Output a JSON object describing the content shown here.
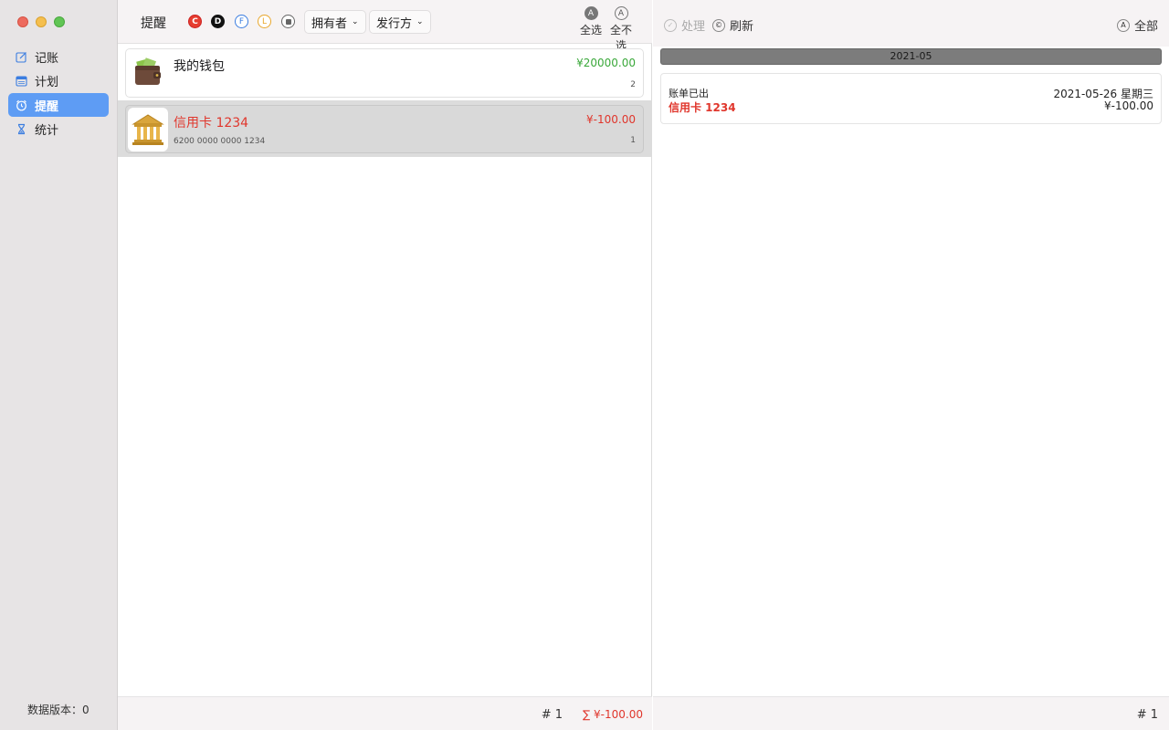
{
  "sidebar": {
    "items": [
      {
        "label": "记账",
        "icon": "edit-icon",
        "active": false
      },
      {
        "label": "计划",
        "icon": "calendar-icon",
        "active": false
      },
      {
        "label": "提醒",
        "icon": "alarm-clock-icon",
        "active": true
      },
      {
        "label": "统计",
        "icon": "hourglass-icon",
        "active": false
      }
    ],
    "footer": "数据版本：0"
  },
  "middle": {
    "title": "提醒",
    "filters": {
      "c": "C",
      "d": "D",
      "f": "F",
      "l": "L"
    },
    "owner_dropdown": "拥有者",
    "issuer_dropdown": "发行方",
    "select_all": {
      "icon": "A",
      "label": "全选"
    },
    "select_none": {
      "icon": "A",
      "label": "全不选"
    },
    "accounts": [
      {
        "name": "我的钱包",
        "amount": "¥20000.00",
        "sub": "",
        "count": "2",
        "icon": "wallet-icon",
        "amount_color": "#3aa83a"
      },
      {
        "name": "信用卡 1234",
        "amount": "¥-100.00",
        "sub": "6200 0000 0000 1234",
        "count": "1",
        "icon": "bank-icon",
        "amount_color": "#e0362c",
        "selected": true
      }
    ],
    "footer": {
      "count": "#  1",
      "sum": "∑  ¥-100.00"
    }
  },
  "right": {
    "process_label": "处理",
    "refresh_label": "刷新",
    "all_label": "全部",
    "all_icon": "A",
    "month": "2021-05",
    "bill": {
      "status": "账单已出",
      "account": "信用卡 1234",
      "date": "2021-05-26 星期三",
      "amount": "¥-100.00"
    },
    "footer": {
      "count": "#  1"
    }
  },
  "colors": {
    "accent": "#5e9cf4",
    "positive": "#3aa83a",
    "negative": "#e0362c"
  }
}
